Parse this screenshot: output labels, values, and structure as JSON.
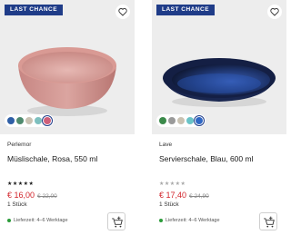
{
  "products": [
    {
      "badge": "LAST CHANCE",
      "brand": "Perlemor",
      "title": "Müslischale, Rosa, 550 ml",
      "stars": "★★★★★",
      "price": "€ 16,00",
      "old_price": "€ 22,00",
      "unit": "1 Stück",
      "delivery": "Lieferzeit: 4–6 Werktage",
      "swatches": [
        "#2f5fa6",
        "#4f8a6e",
        "#c9c2b2",
        "#7ec0bf",
        "#cf5f7a"
      ],
      "selected_swatch": 4,
      "image_icon": "pink-bowl-image"
    },
    {
      "badge": "LAST CHANCE",
      "brand": "Lave",
      "title": "Servierschale, Blau, 600 ml",
      "stars": "★★★★★",
      "price": "€ 17,40",
      "old_price": "€ 24,90",
      "unit": "1 Stück",
      "delivery": "Lieferzeit: 4–6 Werktage",
      "swatches": [
        "#3b8a4a",
        "#9a9a9a",
        "#c9c2b2",
        "#6ac3c7",
        "#2f67c4"
      ],
      "selected_swatch": 4,
      "image_icon": "blue-plate-image"
    }
  ]
}
